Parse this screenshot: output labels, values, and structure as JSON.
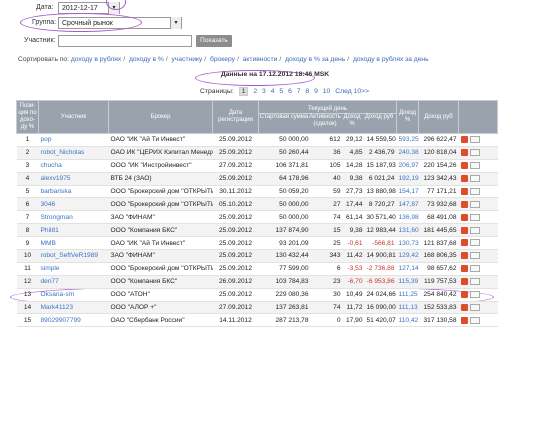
{
  "filters": {
    "date_label": "Дата:",
    "date_value": "2012-12-17",
    "group_label": "Группа:",
    "group_value": "Срочный рынок",
    "participant_label": "Участник:",
    "participant_value": "",
    "show_button": "Показать"
  },
  "sort": {
    "label": "Сортировать по:",
    "options": [
      "доходу в рублях",
      "доходу в %",
      "участнику",
      "брокеру",
      "активности",
      "доходу в % за день",
      "доходу в рублях за день"
    ]
  },
  "data_heading": "Данные на 17.12.2012 18:46 MSK",
  "pages": {
    "label": "Страницы:",
    "items": [
      "1",
      "2",
      "3",
      "4",
      "5",
      "6",
      "7",
      "8",
      "9",
      "10"
    ],
    "current": "1",
    "next": "След 10>>"
  },
  "table": {
    "headers": {
      "place": "Пози- ция по дохо- ду %",
      "participant": "Участник",
      "broker": "Брокер",
      "reg_date": "Дата регистрации",
      "current_day": "Текущий день",
      "start_sum": "Стартовая сумма",
      "activity": "Активность (сделок)",
      "day_pct": "Доход %",
      "day_rub": "Доход руб",
      "inc_pct": "Доход %",
      "inc_rub": "Доход руб"
    },
    "rows": [
      {
        "n": "1",
        "name": "pop",
        "broker": "ОАО \"ИК \"Ай Ти Инвест\"",
        "date": "25.09.2012",
        "start": "50 000,00",
        "act": "612",
        "dpct": "29,12",
        "drub": "14 559,50",
        "ipct": "593,25",
        "irub": "296 622,47"
      },
      {
        "n": "2",
        "name": "robot_Nicholas",
        "broker": "ОАО ИК \"ЦЕРИХ Кэпитал Менеджмент\"",
        "date": "25.09.2012",
        "start": "50 260,44",
        "act": "36",
        "dpct": "4,85",
        "drub": "2 436,79",
        "ipct": "240,38",
        "irub": "120 818,04"
      },
      {
        "n": "3",
        "name": "chucha",
        "broker": "ООО \"ИК \"Инстройинвест\"",
        "date": "27.09.2012",
        "start": "106 371,81",
        "act": "105",
        "dpct": "14,28",
        "drub": "15 187,93",
        "ipct": "206,97",
        "irub": "220 154,26"
      },
      {
        "n": "4",
        "name": "alexv1975",
        "broker": "ВТБ 24 (ЗАО)",
        "date": "25.09.2012",
        "start": "64 178,96",
        "act": "40",
        "dpct": "9,38",
        "drub": "6 021,24",
        "ipct": "192,19",
        "irub": "123 342,43"
      },
      {
        "n": "5",
        "name": "barbariska",
        "broker": "ООО \"Брокерский дом \"ОТКРЫТИЕ\"",
        "date": "30.11.2012",
        "start": "50 059,20",
        "act": "59",
        "dpct": "27,73",
        "drub": "13 880,98",
        "ipct": "154,17",
        "irub": "77 171,21"
      },
      {
        "n": "6",
        "name": "3046",
        "broker": "ООО \"Брокерский дом \"ОТКРЫТИЕ\"",
        "date": "05.10.2012",
        "start": "50 000,00",
        "act": "27",
        "dpct": "17,44",
        "drub": "8 720,27",
        "ipct": "147,87",
        "irub": "73 932,68"
      },
      {
        "n": "7",
        "name": "Strongman",
        "broker": "ЗАО \"ФИНАМ\"",
        "date": "25.09.2012",
        "start": "50 000,00",
        "act": "74",
        "dpct": "61,14",
        "drub": "30 571,40",
        "ipct": "136,98",
        "irub": "68 491,08"
      },
      {
        "n": "8",
        "name": "Phil81",
        "broker": "ООО \"Компания БКС\"",
        "date": "25.09.2012",
        "start": "137 874,90",
        "act": "15",
        "dpct": "9,38",
        "drub": "12 983,44",
        "ipct": "131,60",
        "irub": "181 445,65"
      },
      {
        "n": "9",
        "name": "MMB",
        "broker": "ОАО \"ИК \"Ай Ти Инвест\"",
        "date": "25.09.2012",
        "start": "93 201,09",
        "act": "25",
        "dpct": "-0,61",
        "drub": "-566,81",
        "ipct": "130,73",
        "irub": "121 837,68"
      },
      {
        "n": "10",
        "name": "robot_SeftVeR1989",
        "broker": "ЗАО \"ФИНАМ\"",
        "date": "25.09.2012",
        "start": "130 432,44",
        "act": "343",
        "dpct": "11,42",
        "drub": "14 900,81",
        "ipct": "129,42",
        "irub": "168 806,35"
      },
      {
        "n": "11",
        "name": "simple",
        "broker": "ООО \"Брокерский дом \"ОТКРЫТИЕ\"",
        "date": "25.09.2012",
        "start": "77 599,00",
        "act": "6",
        "dpct": "-3,53",
        "drub": "-2 736,88",
        "ipct": "127,14",
        "irub": "98 657,62"
      },
      {
        "n": "12",
        "name": "den77",
        "broker": "ООО \"Компания БКС\"",
        "date": "26.09.2012",
        "start": "103 784,83",
        "act": "23",
        "dpct": "-6,70",
        "drub": "-6 953,86",
        "ipct": "115,39",
        "irub": "119 757,53"
      },
      {
        "n": "13",
        "name": "Oksana-sm",
        "broker": "ООО \"АТОН\"",
        "date": "25.09.2012",
        "start": "229 080,36",
        "act": "30",
        "dpct": "10,49",
        "drub": "24 024,66",
        "ipct": "111,25",
        "irub": "254 840,42"
      },
      {
        "n": "14",
        "name": "Mark41123",
        "broker": "ООО \"АЛОР +\"",
        "date": "27.09.2012",
        "start": "137 263,81",
        "act": "74",
        "dpct": "11,72",
        "drub": "16 090,00",
        "ipct": "111,13",
        "irub": "152 533,83"
      },
      {
        "n": "15",
        "name": "89029907799",
        "broker": "ОАО \"Сбербанк России\"",
        "date": "14.11.2012",
        "start": "287 213,78",
        "act": "0",
        "dpct": "17,90",
        "drub": "51 420,07",
        "ipct": "110,42",
        "irub": "317 130,58"
      }
    ]
  },
  "colors": {
    "link": "#3a6ab8",
    "header_bg": "#9aa3ad",
    "annotation": "#a75bd0",
    "negative": "#c0392b"
  }
}
